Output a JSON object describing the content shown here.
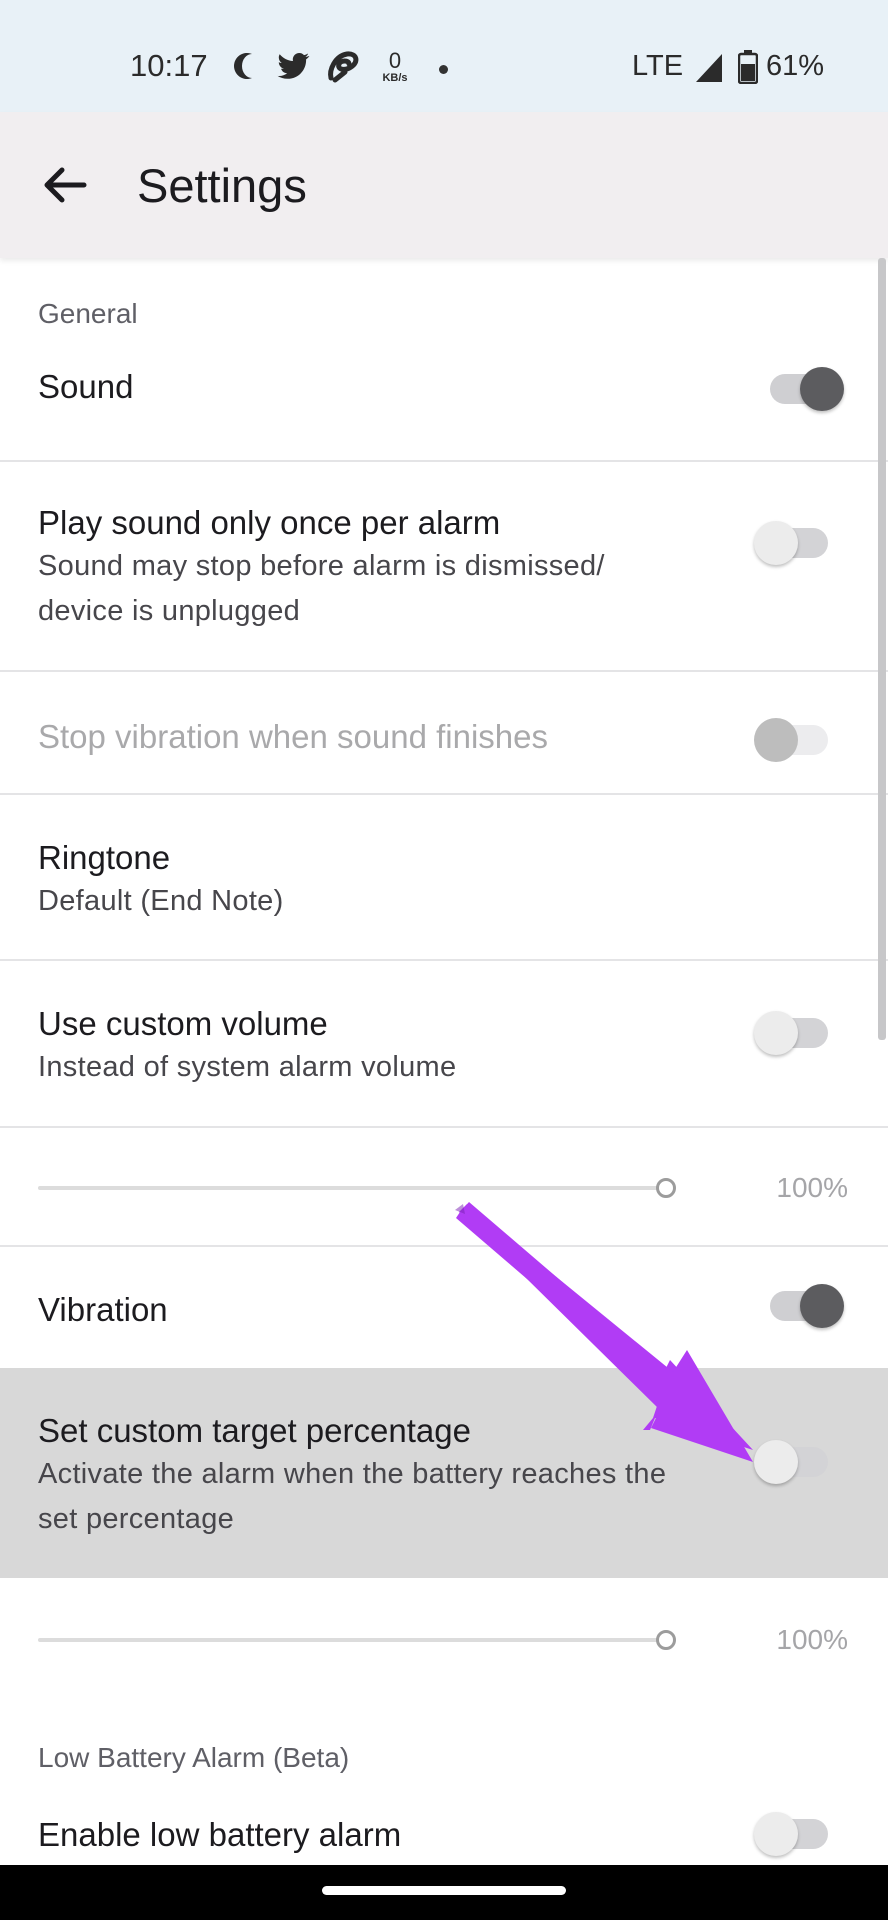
{
  "status_bar": {
    "time": "10:17",
    "icons": [
      "moon-icon",
      "twitter-icon",
      "airtel-icon"
    ],
    "net_speed_value": "0",
    "net_speed_unit": "KB/s",
    "network": "LTE",
    "battery_percent": "61%"
  },
  "app_bar": {
    "back_icon": "arrow-left-icon",
    "title": "Settings"
  },
  "sections": {
    "general": "General",
    "low_battery": "Low Battery Alarm (Beta)"
  },
  "settings": {
    "sound": {
      "title": "Sound",
      "enabled": true
    },
    "play_once": {
      "title": "Play sound only once per alarm",
      "subtitle": "Sound may stop before alarm is dismissed/ device is unplugged",
      "enabled": false
    },
    "stop_vibration": {
      "title": "Stop vibration when sound finishes",
      "enabled": false,
      "disabled": true
    },
    "ringtone": {
      "title": "Ringtone",
      "subtitle": "Default (End Note)"
    },
    "custom_volume": {
      "title": "Use custom volume",
      "subtitle": "Instead of system alarm volume",
      "enabled": false
    },
    "volume_slider": {
      "value_label": "100%",
      "value": 1.0
    },
    "vibration": {
      "title": "Vibration",
      "enabled": true
    },
    "custom_target": {
      "title": "Set custom target percentage",
      "subtitle": "Activate the alarm when the battery reaches the set percentage",
      "enabled": false
    },
    "target_slider": {
      "value_label": "100%",
      "value": 1.0
    },
    "low_battery_alarm": {
      "title": "Enable low battery alarm",
      "enabled": false
    }
  },
  "colors": {
    "status_bar_bg": "#e8f1f7",
    "app_bar_bg": "#f1eef0",
    "highlight_bg": "#d8d8d8",
    "arrow": "#b13cf5"
  }
}
